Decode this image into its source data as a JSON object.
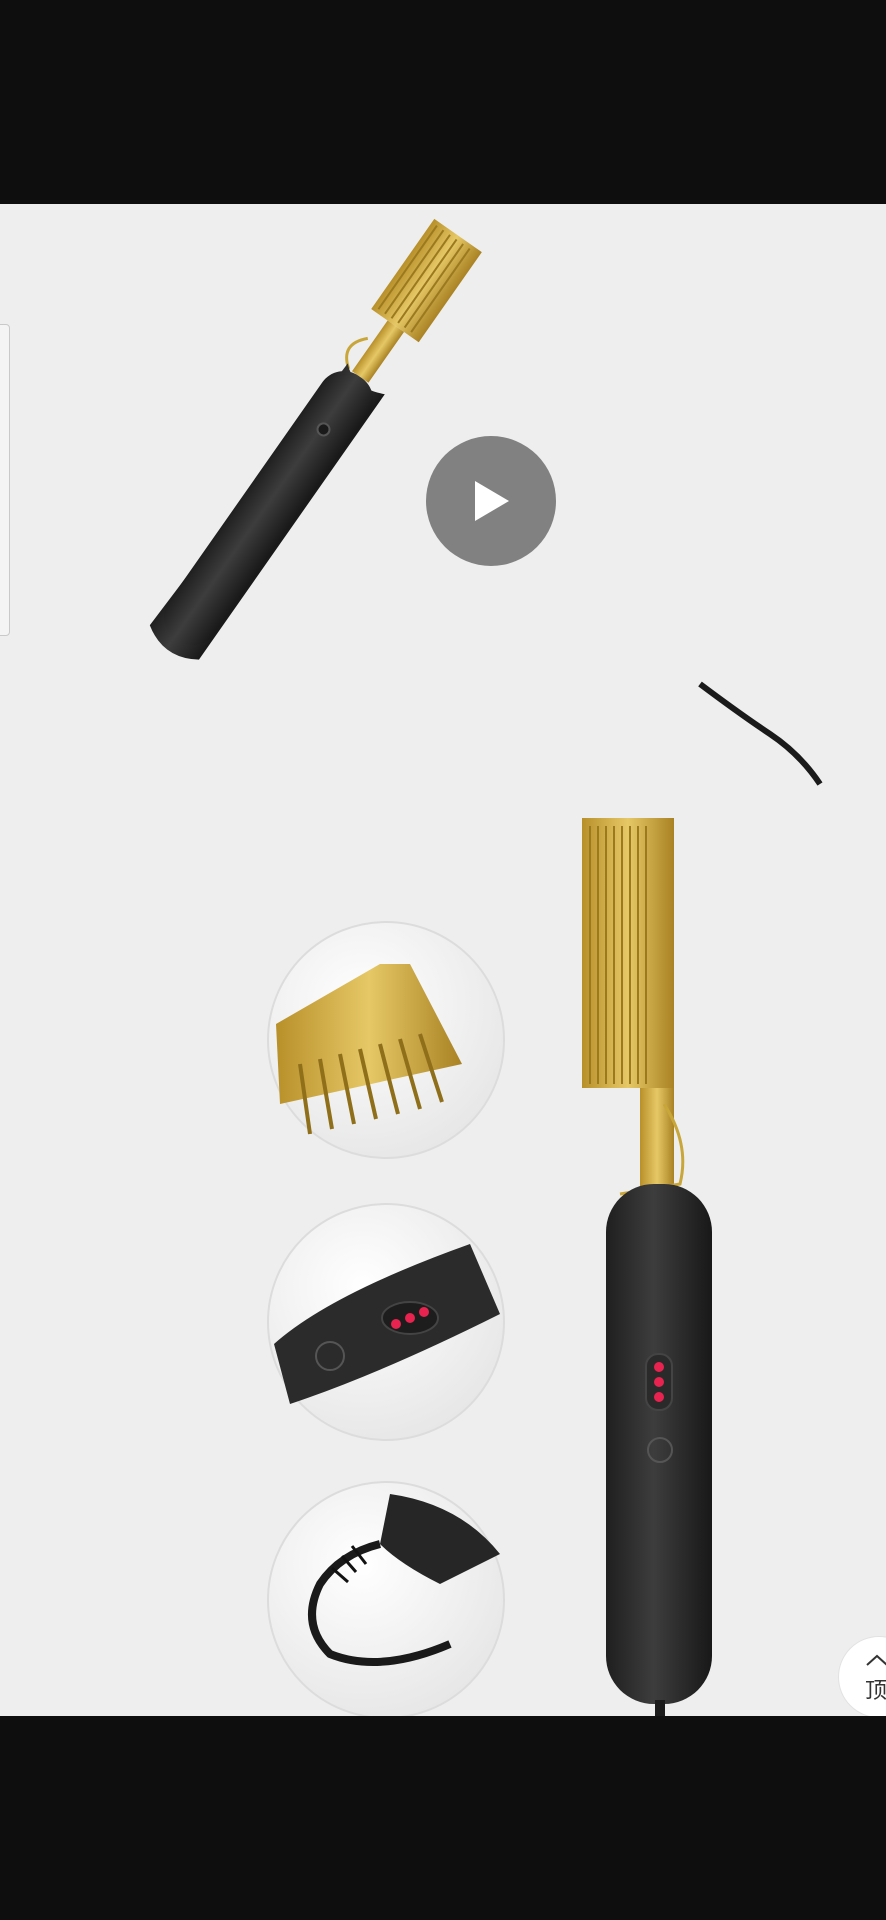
{
  "player": {
    "play_icon": "play-icon"
  },
  "back_to_top": {
    "label": "顶",
    "icon": "chevron-up-icon"
  },
  "colors": {
    "letterbox": "#0e0e0e",
    "background": "#eeeeee",
    "gold": "#c9a63a",
    "handle": "#2c2c2c",
    "indicator": "#e8234f"
  }
}
